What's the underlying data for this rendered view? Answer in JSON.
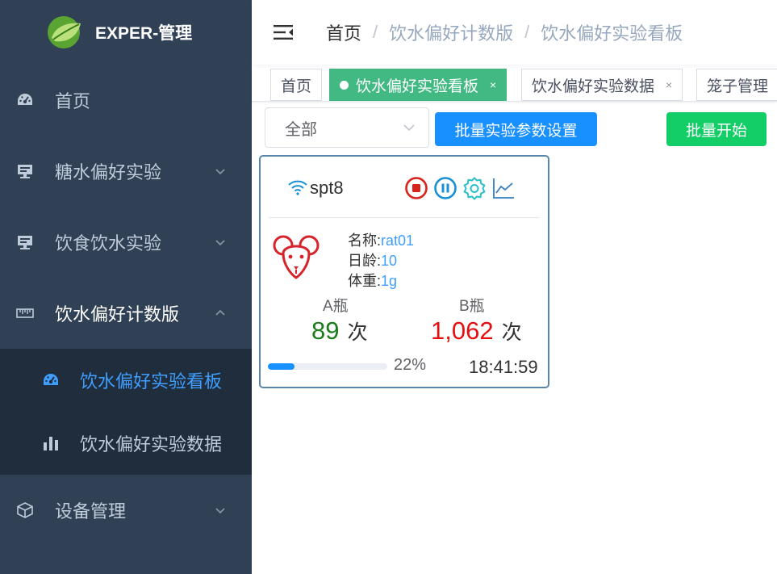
{
  "app": {
    "title": "EXPER-管理"
  },
  "sidebar": {
    "items": [
      {
        "label": "首页",
        "icon": "dashboard-icon"
      },
      {
        "label": "糖水偏好实验",
        "icon": "monitor-icon"
      },
      {
        "label": "饮食饮水实验",
        "icon": "monitor-icon"
      },
      {
        "label": "饮水偏好计数版",
        "icon": "ruler-icon",
        "open": true
      },
      {
        "label": "设备管理",
        "icon": "cube-icon"
      }
    ],
    "submenu": [
      {
        "label": "饮水偏好实验看板",
        "icon": "dashboard-icon",
        "active": true
      },
      {
        "label": "饮水偏好实验数据",
        "icon": "bar-chart-icon"
      }
    ]
  },
  "breadcrumb": [
    "首页",
    "饮水偏好计数版",
    "饮水偏好实验看板"
  ],
  "tags": [
    {
      "label": "首页",
      "active": false
    },
    {
      "label": "饮水偏好实验看板",
      "active": true,
      "close": "×"
    },
    {
      "label": "饮水偏好实验数据",
      "active": false,
      "close": "×"
    },
    {
      "label": "笼子管理",
      "active": false
    }
  ],
  "toolbar": {
    "filter_value": "全部",
    "batch_settings_label": "批量实验参数设置",
    "batch_start_label": "批量开始"
  },
  "device": {
    "name": "spt8",
    "name_label": "名称:",
    "name_value": "rat01",
    "age_label": "日龄:",
    "age_value": "10",
    "weight_label": "体重:",
    "weight_value": "1g",
    "bottle_a_label": "A瓶",
    "bottle_a_count": "89",
    "bottle_b_label": "B瓶",
    "bottle_b_count": "1,062",
    "count_unit": "次",
    "progress": 22,
    "progress_text": "22%",
    "time": "18:41:59"
  },
  "colors": {
    "sidebar_bg": "#304156",
    "submenu_bg": "#1f2d3d",
    "active_link": "#409eff",
    "tag_active": "#42b983",
    "btn_blue": "#1890ff",
    "btn_green": "#13ce66",
    "count_a": "#1b7c1b",
    "count_b": "#e60f0f",
    "stop_red": "#d8231b",
    "pause_blue": "#1890d6",
    "gear_teal": "#2bc0c8",
    "chart_blue": "#2f7ec1",
    "mouse_red": "#d8232a"
  }
}
